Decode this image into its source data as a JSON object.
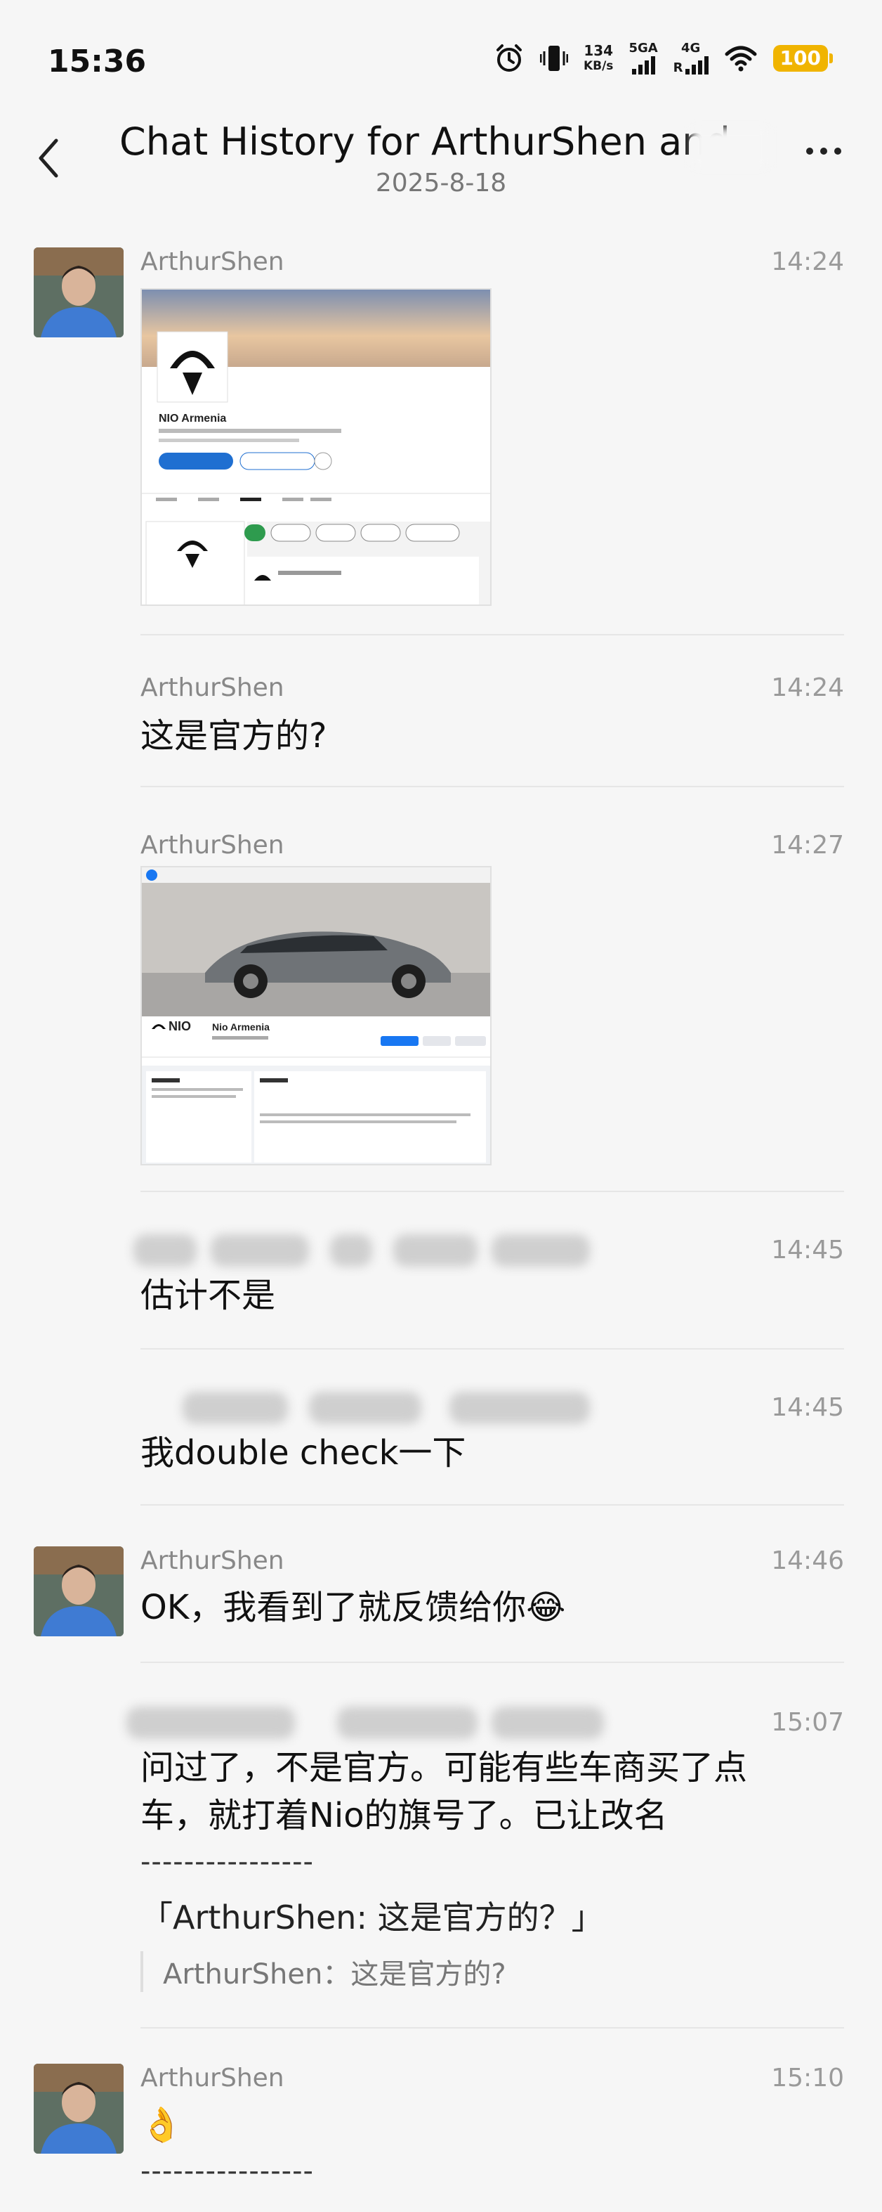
{
  "status_bar": {
    "time": "15:36",
    "net_speed_value": "134",
    "net_speed_unit": "KB/s",
    "signal1_label": "5GA",
    "signal2_label": "4G",
    "signal2_sub": "R",
    "battery": "100"
  },
  "header": {
    "title": "Chat History for ArthurShen and",
    "date": "2025-8-18"
  },
  "messages": [
    {
      "sender": "ArthurShen",
      "time": "14:24",
      "image_desc": "NIO Armenia"
    },
    {
      "sender": "ArthurShen",
      "time": "14:24",
      "text": "这是官方的?"
    },
    {
      "sender": "ArthurShen",
      "time": "14:27",
      "image_desc": "Nio Armenia"
    },
    {
      "time": "14:45",
      "text": "估计不是"
    },
    {
      "time": "14:45",
      "text": "我double check一下"
    },
    {
      "sender": "ArthurShen",
      "time": "14:46",
      "text": "OK，我看到了就反馈给你😂"
    },
    {
      "time": "15:07",
      "text_line1": "问过了，不是官方。可能有些车商买了点",
      "text_line2": "车，就打着Nio的旗号了。已让改名",
      "separator": "----------------",
      "quote": "「ArthurShen: 这是官方的？」",
      "quote_ref": "ArthurShen：这是官方的?"
    },
    {
      "sender": "ArthurShen",
      "time": "15:10",
      "text": "👌",
      "separator": "----------------"
    }
  ],
  "icons": [
    "back-arrow-icon",
    "more-dots-icon",
    "alarm-icon",
    "vibrate-icon",
    "wifi-icon",
    "battery-icon",
    "signal-icon",
    "avatar"
  ],
  "colors": {
    "background": "#f6f6f6",
    "battery": "#f0b400",
    "link_blue": "#1f6fd1"
  }
}
